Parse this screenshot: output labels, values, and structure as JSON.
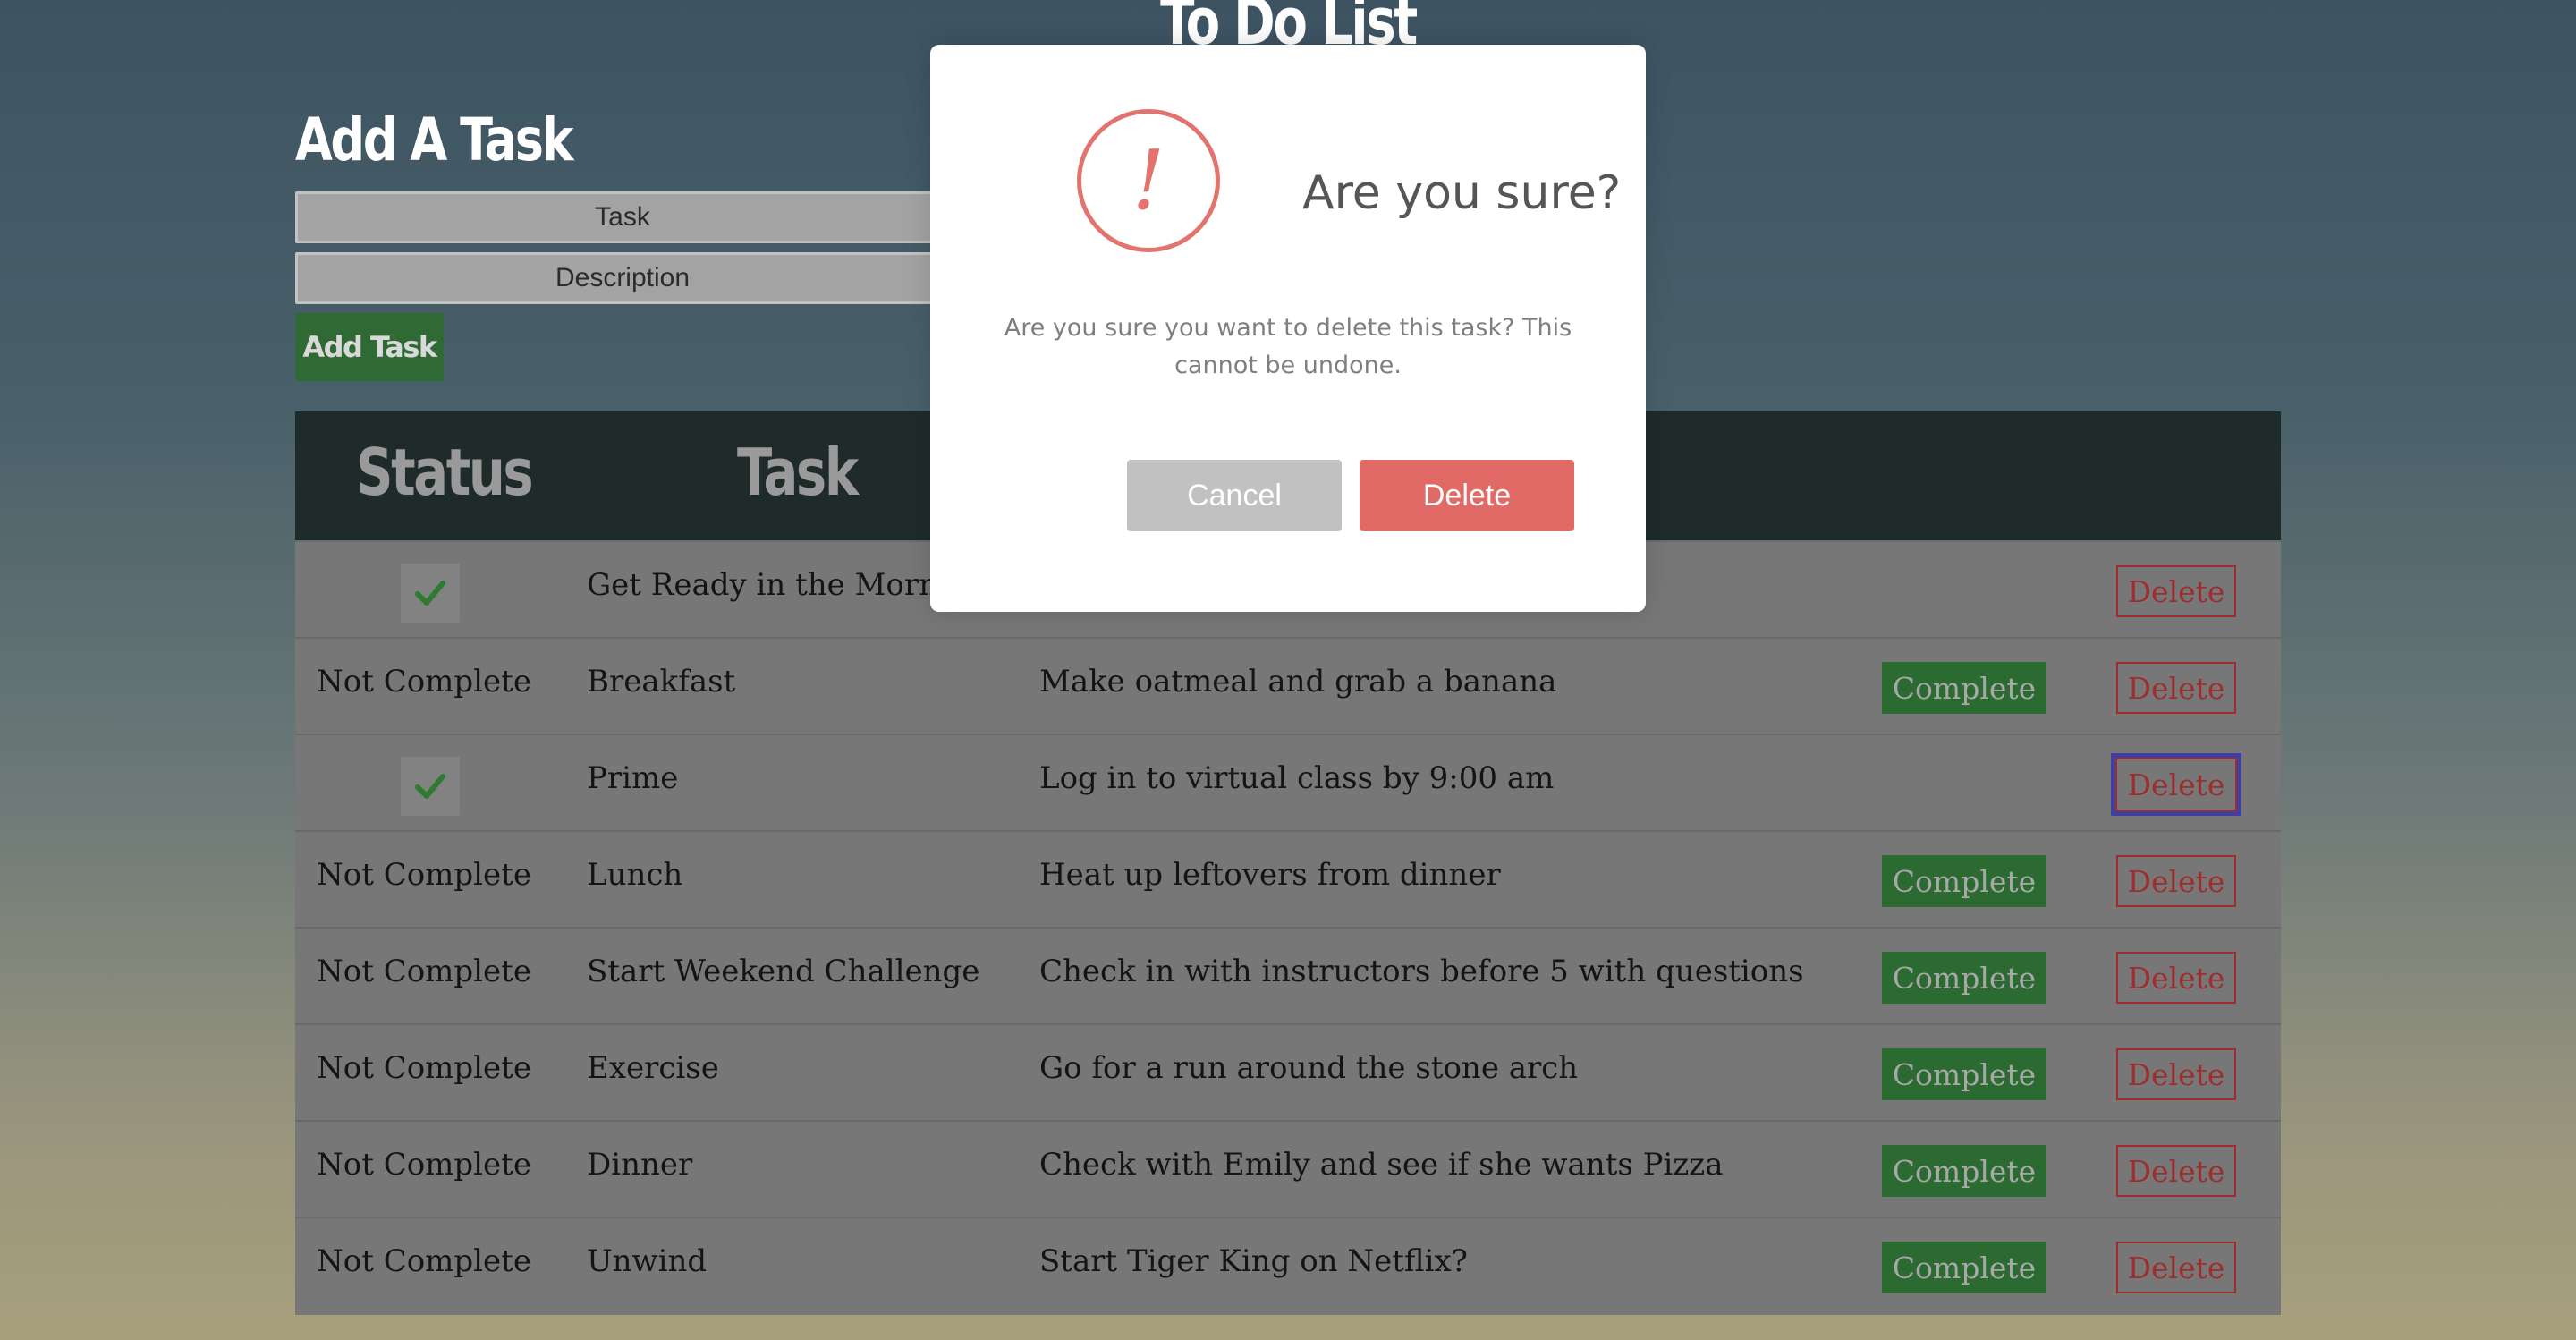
{
  "app": {
    "title": "To Do List"
  },
  "form": {
    "heading": "Add A Task",
    "task_placeholder": "Task",
    "description_placeholder": "Description",
    "add_button": "Add Task"
  },
  "table": {
    "headers": {
      "status": "Status",
      "task": "Task"
    },
    "complete_label": "Complete",
    "delete_label": "Delete",
    "rows": [
      {
        "status": "complete",
        "task": "Get Ready in the Morning",
        "description": ""
      },
      {
        "status": "Not Complete",
        "task": "Breakfast",
        "description": "Make oatmeal and grab a banana"
      },
      {
        "status": "complete",
        "task": "Prime",
        "description": "Log in to virtual class by 9:00 am"
      },
      {
        "status": "Not Complete",
        "task": "Lunch",
        "description": "Heat up leftovers from dinner"
      },
      {
        "status": "Not Complete",
        "task": "Start Weekend Challenge",
        "description": "Check in with instructors before 5 with questions"
      },
      {
        "status": "Not Complete",
        "task": "Exercise",
        "description": "Go for a run around the stone arch"
      },
      {
        "status": "Not Complete",
        "task": "Dinner",
        "description": "Check with Emily and see if she wants Pizza"
      },
      {
        "status": "Not Complete",
        "task": "Unwind",
        "description": "Start Tiger King on Netflix?"
      }
    ]
  },
  "modal": {
    "icon": "exclamation-icon",
    "icon_glyph": "!",
    "title": "Are you sure?",
    "text": "Are you sure you want to delete this task? This cannot be undone.",
    "cancel_label": "Cancel",
    "delete_label": "Delete"
  },
  "colors": {
    "complete_button": "#2b6a31",
    "delete_border": "#9e2d2d",
    "modal_accent": "#e2736e",
    "modal_delete": "#e26a66",
    "modal_cancel": "#c1c1c1"
  }
}
